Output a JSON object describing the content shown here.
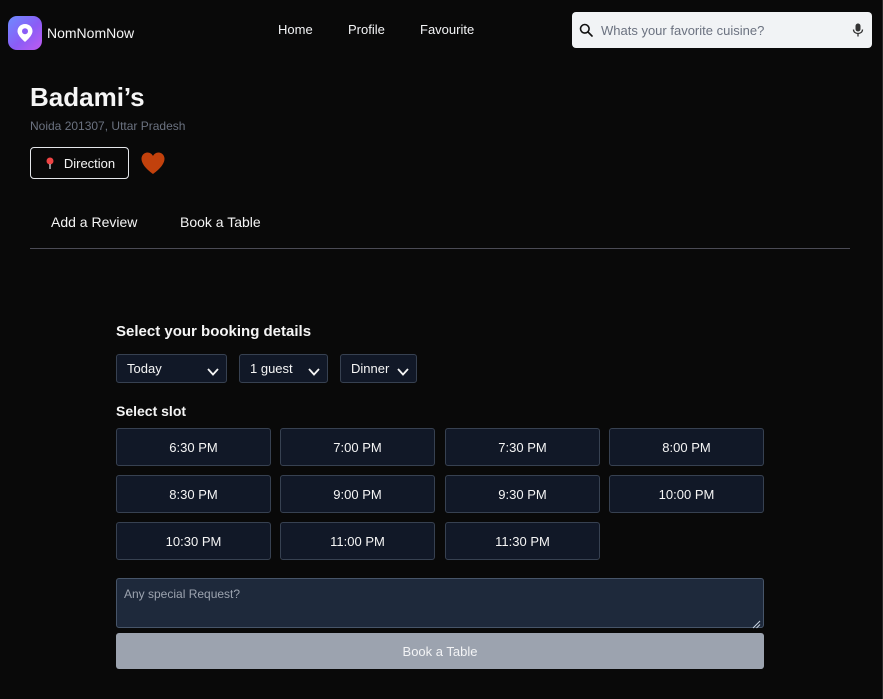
{
  "app": {
    "name": "NomNomNow",
    "icon": "location-pin-logo-icon"
  },
  "nav": {
    "items": [
      {
        "label": "Home"
      },
      {
        "label": "Profile"
      },
      {
        "label": "Favourite"
      }
    ]
  },
  "search": {
    "placeholder": "Whats your favorite cuisine?",
    "icon": "search-icon",
    "voice_icon": "microphone-icon"
  },
  "restaurant": {
    "name": "Badami’s",
    "address": "Noida 201307, Uttar Pradesh",
    "direction_label": "Direction",
    "favourite_icon": "heart-icon",
    "favourite_color": "#c2410c"
  },
  "tabs": [
    {
      "label": "Add a Review"
    },
    {
      "label": "Book a Table"
    }
  ],
  "booking": {
    "title": "Select your booking details",
    "day": "Today",
    "guests": "1 guest",
    "meal": "Dinner",
    "slot_title": "Select slot",
    "slots": [
      "6:30 PM",
      "7:00 PM",
      "7:30 PM",
      "8:00 PM",
      "8:30 PM",
      "9:00 PM",
      "9:30 PM",
      "10:00 PM",
      "10:30 PM",
      "11:00 PM",
      "11:30 PM"
    ],
    "request_placeholder": "Any special Request?",
    "submit_label": "Book a Table"
  },
  "colors": {
    "background": "#090909",
    "panel": "#111827",
    "border": "#374151",
    "button_disabled": "#9ca3af",
    "logo_gradient_start": "#6d8cff",
    "logo_gradient_end": "#c15bf0"
  }
}
